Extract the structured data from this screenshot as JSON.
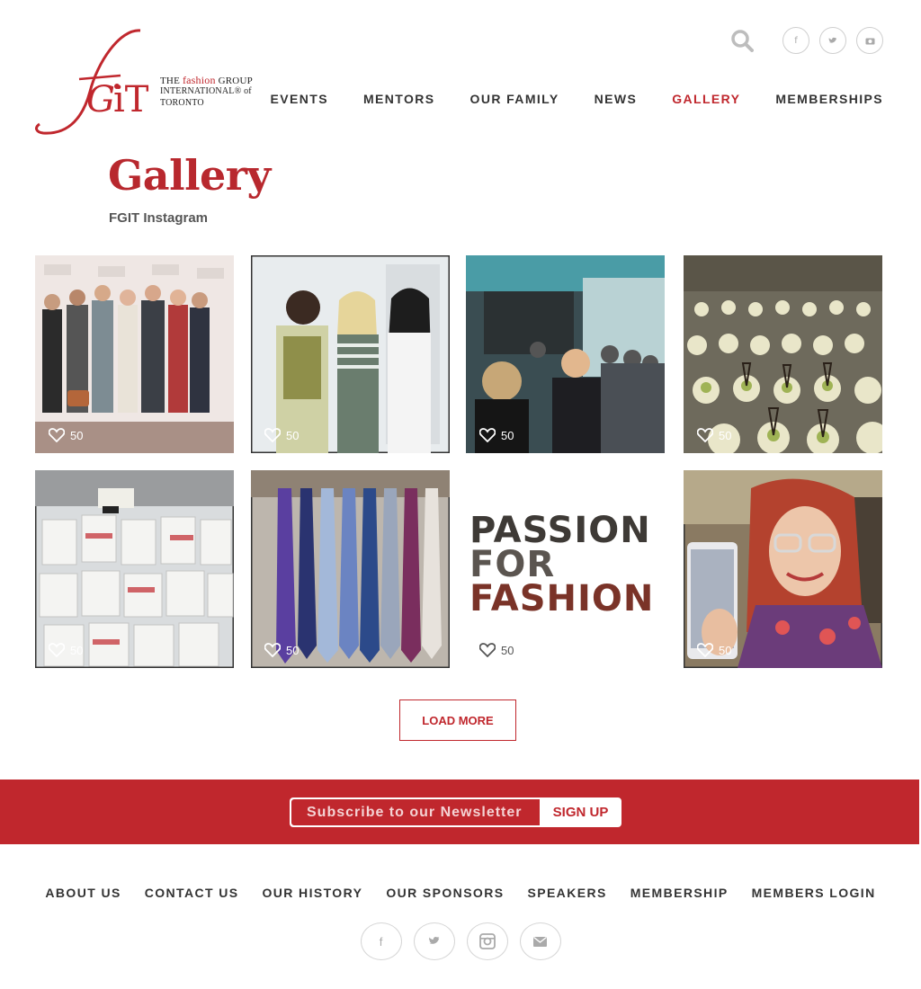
{
  "brand": {
    "logo_mark": "fGiT",
    "line1_prefix": "THE",
    "line1_accent": "fashion",
    "line1_suffix": "GROUP",
    "line2": "INTERNATIONAL® of",
    "line3": "TORONTO",
    "accent_color": "#c0272d"
  },
  "header": {
    "search_icon": "search-icon",
    "social": [
      {
        "name": "facebook-icon",
        "glyph": "f"
      },
      {
        "name": "twitter-icon",
        "glyph": "♥"
      },
      {
        "name": "camera-icon",
        "glyph": "▣"
      }
    ],
    "nav": [
      {
        "label": "EVENTS",
        "active": false
      },
      {
        "label": "MENTORS",
        "active": false
      },
      {
        "label": "OUR FAMILY",
        "active": false
      },
      {
        "label": "NEWS",
        "active": false
      },
      {
        "label": "GALLERY",
        "active": true
      },
      {
        "label": "MEMBERSHIPS",
        "active": false
      }
    ]
  },
  "page": {
    "title": "Gallery",
    "subtitle": "FGIT Instagram"
  },
  "gallery": {
    "tiles": [
      {
        "likes": "50",
        "scene": "group-photo-backdrop"
      },
      {
        "likes": "50",
        "scene": "three-people-portrait"
      },
      {
        "likes": "50",
        "scene": "crowd-at-event"
      },
      {
        "likes": "50",
        "scene": "dessert-cups"
      },
      {
        "likes": "50",
        "scene": "gift-bags"
      },
      {
        "likes": "50",
        "scene": "neckties-display"
      },
      {
        "likes": "50",
        "scene": "passion-for-fashion-text",
        "text_lines": [
          "PASSION",
          "FOR",
          "FASHION"
        ]
      },
      {
        "likes": "50",
        "scene": "woman-selfie-phone"
      }
    ],
    "load_more_label": "LOAD MORE"
  },
  "newsletter": {
    "placeholder": "Subscribe to our Newsletter",
    "button_label": "SIGN UP"
  },
  "footer": {
    "nav": [
      "ABOUT US",
      "CONTACT US",
      "OUR HISTORY",
      "OUR SPONSORS",
      "SPEAKERS",
      "MEMBERSHIP",
      "MEMBERS LOGIN"
    ],
    "social": [
      {
        "name": "facebook-icon",
        "glyph": "f"
      },
      {
        "name": "twitter-icon",
        "glyph": "♥"
      },
      {
        "name": "instagram-icon",
        "glyph": "▣"
      },
      {
        "name": "email-icon",
        "glyph": "✉"
      }
    ]
  }
}
